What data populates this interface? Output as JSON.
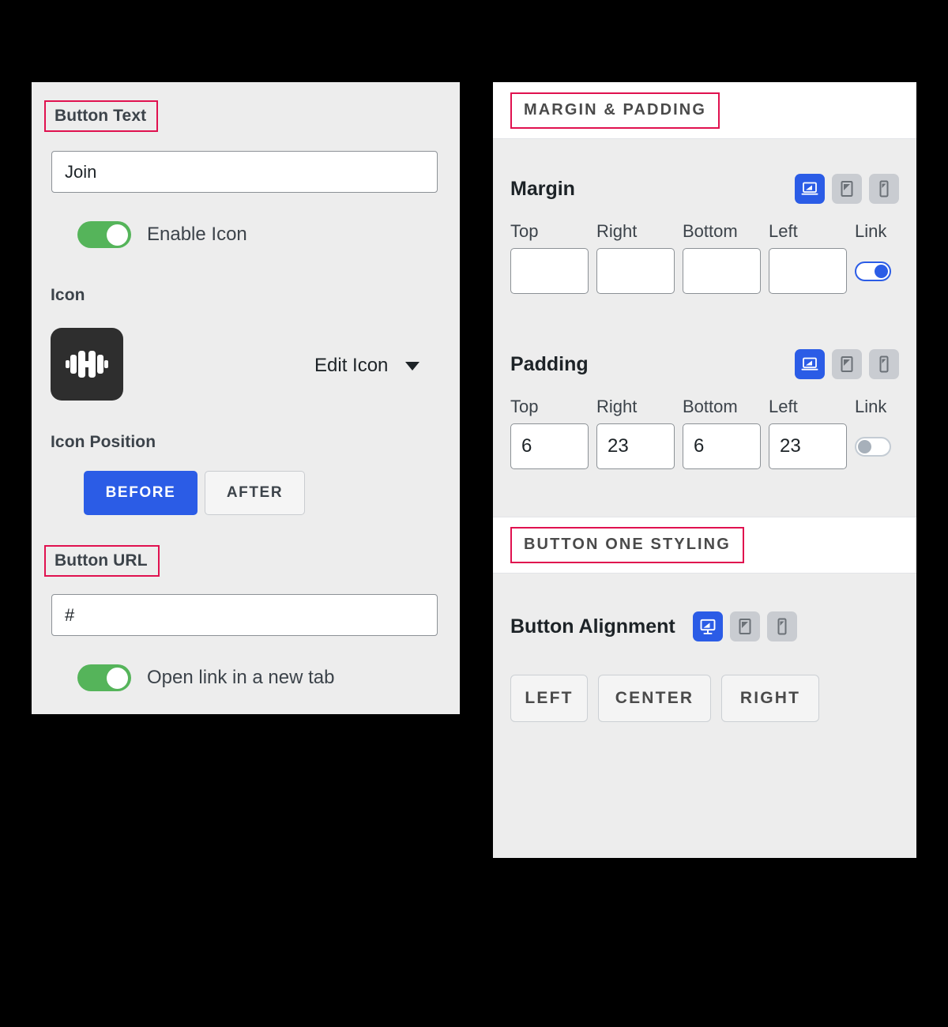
{
  "left_panel": {
    "button_text": {
      "label": "Button Text",
      "highlighted": true,
      "value": "Join",
      "placeholder": "Button Text"
    },
    "enable_icon": {
      "label": "Enable Icon",
      "state": "on"
    },
    "icon": {
      "label": "Icon",
      "glyph": "dumbbell-icon",
      "edit_label": "Edit Icon",
      "dropdown": "chevron-down-icon"
    },
    "icon_position": {
      "label": "Icon Position",
      "options": [
        "BEFORE",
        "AFTER"
      ],
      "selected": "BEFORE"
    },
    "button_url": {
      "label": "Button URL",
      "highlighted": true,
      "value": "#",
      "placeholder": "Button URL"
    },
    "open_new_tab": {
      "label": "Open link in a new tab",
      "state": "on"
    }
  },
  "right_panel": {
    "sections": [
      {
        "title": "MARGIN & PADDING",
        "highlighted": true
      },
      {
        "title": "BUTTON ONE STYLING",
        "highlighted": true
      }
    ],
    "margin": {
      "label": "Margin",
      "devices": [
        "desktop-icon",
        "tablet-icon",
        "mobile-icon"
      ],
      "device_selected": "desktop-icon",
      "fields": [
        "Top",
        "Right",
        "Bottom",
        "Left"
      ],
      "link_label": "Link",
      "values": [
        "",
        "",
        "",
        ""
      ],
      "link_state": "on"
    },
    "padding": {
      "label": "Padding",
      "devices": [
        "desktop-icon",
        "tablet-icon",
        "mobile-icon"
      ],
      "device_selected": "desktop-icon",
      "fields": [
        "Top",
        "Right",
        "Bottom",
        "Left"
      ],
      "link_label": "Link",
      "values": [
        "6",
        "23",
        "6",
        "23"
      ],
      "link_state": "off"
    },
    "button_alignment": {
      "label": "Button Alignment",
      "devices": [
        "monitor-icon",
        "tablet-icon",
        "mobile-icon"
      ],
      "device_selected": "monitor-icon",
      "options": [
        "LEFT",
        "CENTER",
        "RIGHT"
      ],
      "selected": ""
    }
  },
  "colors": {
    "highlight": "#e0114f",
    "accent_blue": "#2b5ce6",
    "toggle_green": "#55b45a",
    "panel_bg": "#ededed",
    "header_bg": "#ffffff",
    "page_bg": "#000000"
  }
}
